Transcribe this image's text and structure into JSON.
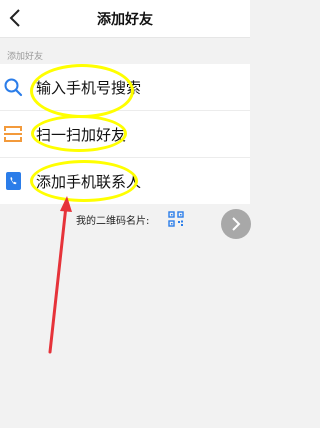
{
  "header": {
    "title": "添加好友"
  },
  "section": {
    "label": "添加好友"
  },
  "list": [
    {
      "label": "输入手机号搜索",
      "icon": "search-icon"
    },
    {
      "label": "扫一扫加好友",
      "icon": "scan-icon"
    },
    {
      "label": "添加手机联系人",
      "icon": "contacts-icon"
    }
  ],
  "qr": {
    "label": "我的二维码名片:",
    "icon": "qr-code-icon"
  },
  "colors": {
    "accent": "#2b7de9",
    "scan": "#f39a3b",
    "annotation_oval": "#ffff00",
    "annotation_arrow": "#e6333a"
  }
}
